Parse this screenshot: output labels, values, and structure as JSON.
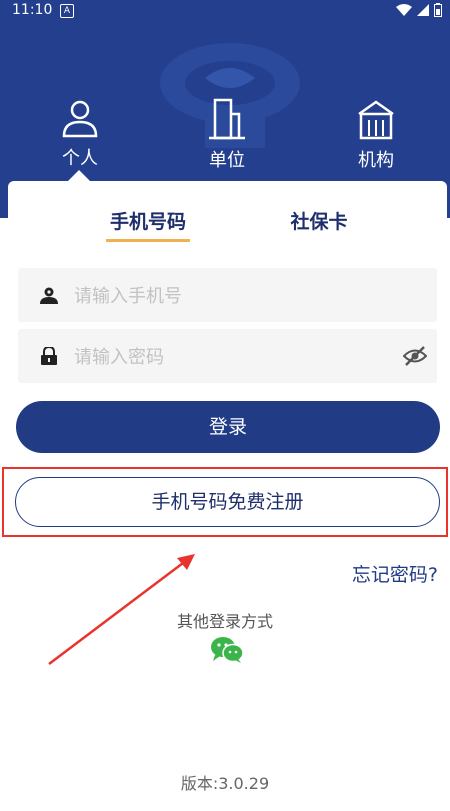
{
  "status_bar": {
    "time": "11:10",
    "notification_icon": "A"
  },
  "colors": {
    "brand": "#243f8e",
    "accent": "#f1b14e",
    "highlight": "#e8342c",
    "wechat": "#3bb54a"
  },
  "role_tabs": [
    {
      "label": "个人",
      "icon": "person-icon",
      "selected": true
    },
    {
      "label": "单位",
      "icon": "building-icon",
      "selected": false
    },
    {
      "label": "机构",
      "icon": "institution-icon",
      "selected": false
    }
  ],
  "login_tabs": [
    {
      "label": "手机号码",
      "selected": true
    },
    {
      "label": "社保卡",
      "selected": false
    }
  ],
  "phone_field": {
    "placeholder": "请输入手机号",
    "value": ""
  },
  "password_field": {
    "placeholder": "请输入密码",
    "value": ""
  },
  "login_button": "登录",
  "register_button": "手机号码免费注册",
  "forgot_password": "忘记密码?",
  "other_login": "其他登录方式",
  "version": "版本:3.0.29"
}
